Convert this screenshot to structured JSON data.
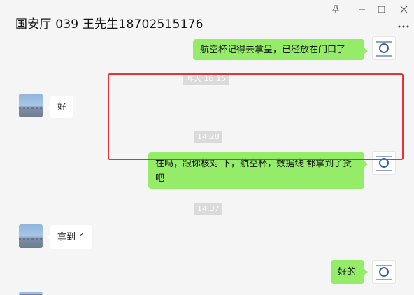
{
  "window": {
    "title": "国安厅 039 王先生18702515176",
    "controls": [
      "pin-icon",
      "minimize-icon",
      "maximize-icon",
      "close-icon",
      "more-icon"
    ]
  },
  "messages": [
    {
      "type": "text",
      "direction": "outgoing",
      "text": "航空杯记得去拿呈，已经放在门口了"
    },
    {
      "type": "time",
      "text": "昨天 16:15"
    },
    {
      "type": "text",
      "direction": "incoming",
      "text": "好"
    },
    {
      "type": "time",
      "text": "14:28"
    },
    {
      "type": "text",
      "direction": "outgoing",
      "text": "在吗，跟你核对 下，航空杯，数据线 都拿到了货吧"
    },
    {
      "type": "time",
      "text": "14:37"
    },
    {
      "type": "text",
      "direction": "incoming",
      "text": "拿到了"
    },
    {
      "type": "text",
      "direction": "outgoing",
      "text": "好的"
    }
  ],
  "colors": {
    "background": "#f5f5f5",
    "outgoing_bubble": "#95ec69",
    "incoming_bubble": "#ffffff",
    "timestamp_bg": "#dadada",
    "highlight_border": "#e53333"
  }
}
